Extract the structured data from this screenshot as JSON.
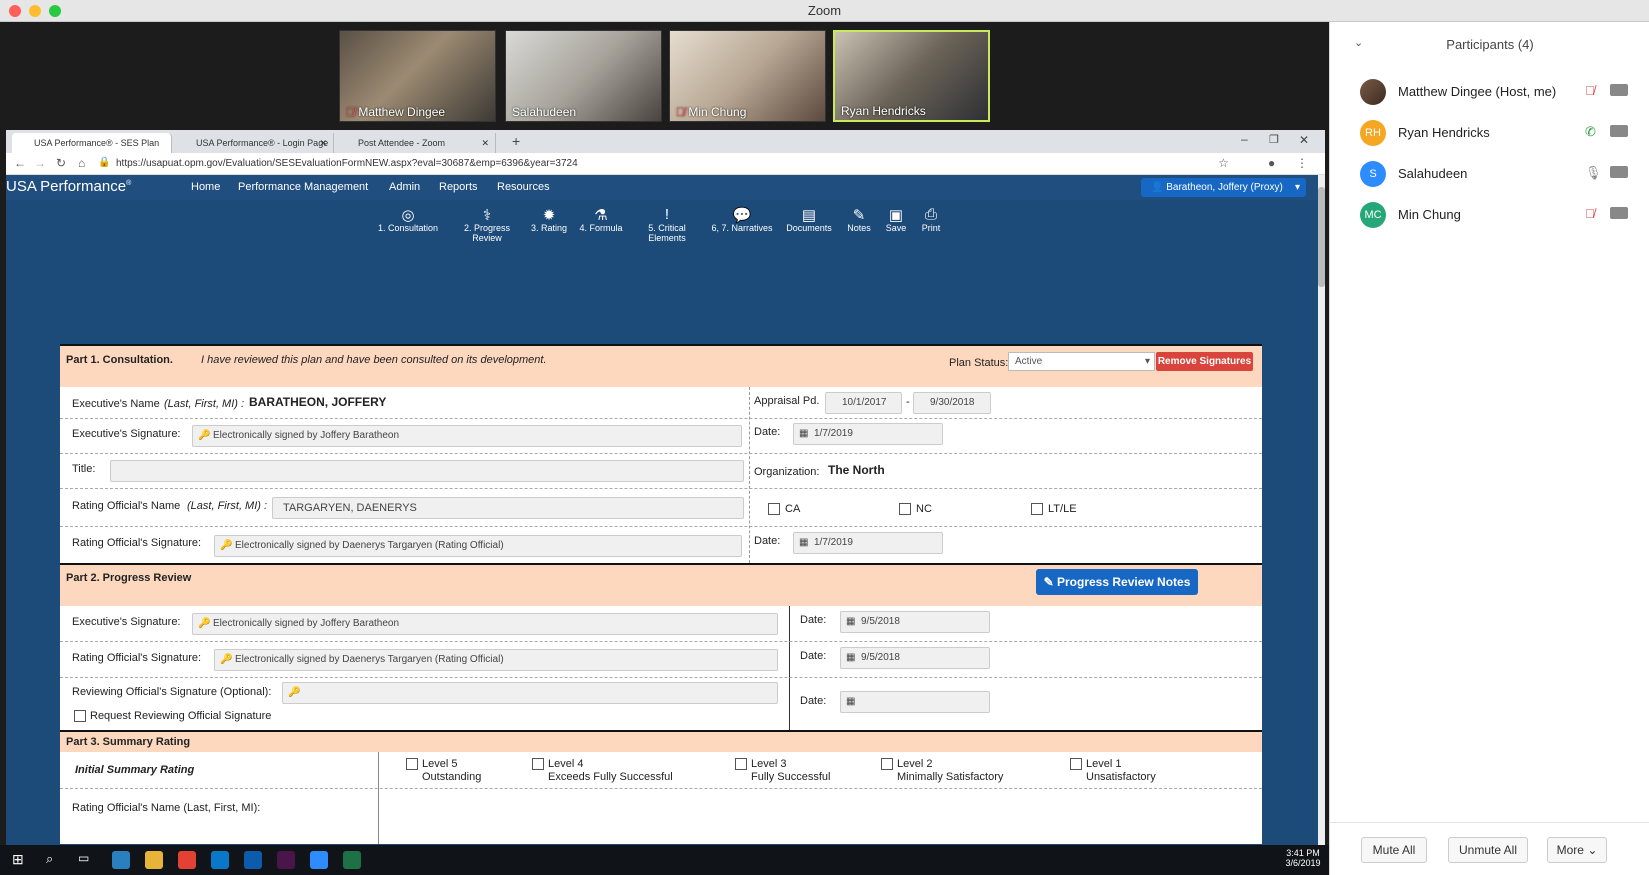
{
  "window": {
    "title": "Zoom"
  },
  "videos": [
    {
      "name": "Matthew Dingee"
    },
    {
      "name": "Salahudeen"
    },
    {
      "name": "Min Chung"
    },
    {
      "name": "Ryan Hendricks"
    }
  ],
  "participants_panel": {
    "title": "Participants (4)",
    "participants": [
      {
        "name": "Matthew Dingee (Host, me)",
        "initials": ""
      },
      {
        "name": "Ryan Hendricks",
        "initials": "RH"
      },
      {
        "name": "Salahudeen",
        "initials": "S"
      },
      {
        "name": "Min Chung",
        "initials": "MC"
      }
    ],
    "mute_all": "Mute All",
    "unmute_all": "Unmute All",
    "more": "More"
  },
  "browser": {
    "tabs": [
      "USA Performance® - SES Plan Pe",
      "USA Performance® - Login Page",
      "Post Attendee - Zoom"
    ],
    "url": "https://usapuat.opm.gov/Evaluation/SESEvaluationFormNEW.aspx?eval=30687&emp=6396&year=3724"
  },
  "app": {
    "logo": "USA Performance",
    "logo_mark": "®",
    "nav": [
      "Home",
      "Performance Management",
      "Admin",
      "Reports",
      "Resources"
    ],
    "user": "Baratheon, Joffery (Proxy)",
    "tools": [
      {
        "l1": "1. Consultation",
        "l2": "",
        "icon": "compass-icon"
      },
      {
        "l1": "2. Progress",
        "l2": "Review",
        "icon": "stethoscope-icon"
      },
      {
        "l1": "3. Rating",
        "l2": "",
        "icon": "badge-icon"
      },
      {
        "l1": "4. Formula",
        "l2": "",
        "icon": "flask-icon"
      },
      {
        "l1": "5. Critical",
        "l2": "Elements",
        "icon": "exclamation-icon"
      },
      {
        "l1": "6, 7. Narratives",
        "l2": "",
        "icon": "comments-icon"
      },
      {
        "l1": "Documents",
        "l2": "",
        "icon": "document-icon"
      },
      {
        "l1": "Notes",
        "l2": "",
        "icon": "edit-icon"
      },
      {
        "l1": "Save",
        "l2": "",
        "icon": "save-icon"
      },
      {
        "l1": "Print",
        "l2": "",
        "icon": "print-icon"
      }
    ]
  },
  "part1": {
    "title": "Part 1. Consultation.",
    "desc": "I have reviewed this plan and have been consulted on its development.",
    "plan_status_label": "Plan Status:",
    "plan_status": "Active",
    "remove_signatures": "Remove Signatures",
    "exec_name_label": "Executive's Name",
    "exec_name_hint": "(Last, First, MI) :",
    "exec_name": "BARATHEON, JOFFERY",
    "appraisal_label": "Appraisal Pd.",
    "appraisal_start": "10/1/2017",
    "appraisal_sep": "-",
    "appraisal_end": "9/30/2018",
    "exec_sig_label": "Executive's Signature:",
    "exec_sig": "Electronically signed by Joffery Baratheon",
    "date_label": "Date:",
    "exec_sig_date": "1/7/2019",
    "title_label": "Title:",
    "org_label": "Organization:",
    "org": "The North",
    "ro_name_label": "Rating Official's Name",
    "ro_name_hint": "(Last, First, MI) :",
    "ro_name": "TARGARYEN, DAENERYS",
    "ca": "CA",
    "nc": "NC",
    "ltle": "LT/LE",
    "ro_sig_label": "Rating Official's Signature:",
    "ro_sig": "Electronically signed by Daenerys Targaryen (Rating Official)",
    "ro_sig_date": "1/7/2019"
  },
  "part2": {
    "title": "Part 2. Progress Review",
    "notes_btn": "Progress Review Notes",
    "exec_sig_label": "Executive's Signature:",
    "exec_sig": "Electronically signed by Joffery Baratheon",
    "date_label": "Date:",
    "exec_date": "9/5/2018",
    "ro_sig_label": "Rating Official's Signature:",
    "ro_sig": "Electronically signed by Daenerys Targaryen (Rating Official)",
    "ro_date": "9/5/2018",
    "rev_label": "Reviewing Official's Signature (Optional):",
    "request_label": "Request Reviewing Official Signature"
  },
  "part3": {
    "title": "Part 3. Summary Rating",
    "initial": "Initial Summary Rating",
    "levels": [
      {
        "l": "Level 5",
        "d": "Outstanding"
      },
      {
        "l": "Level 4",
        "d": "Exceeds Fully Successful"
      },
      {
        "l": "Level 3",
        "d": "Fully Successful"
      },
      {
        "l": "Level 2",
        "d": "Minimally Satisfactory"
      },
      {
        "l": "Level 1",
        "d": "Unsatisfactory"
      }
    ],
    "ro_name_label": "Rating Official's Name (Last, First, MI):"
  },
  "taskbar": {
    "time": "3:41 PM",
    "date": "3/6/2019"
  }
}
